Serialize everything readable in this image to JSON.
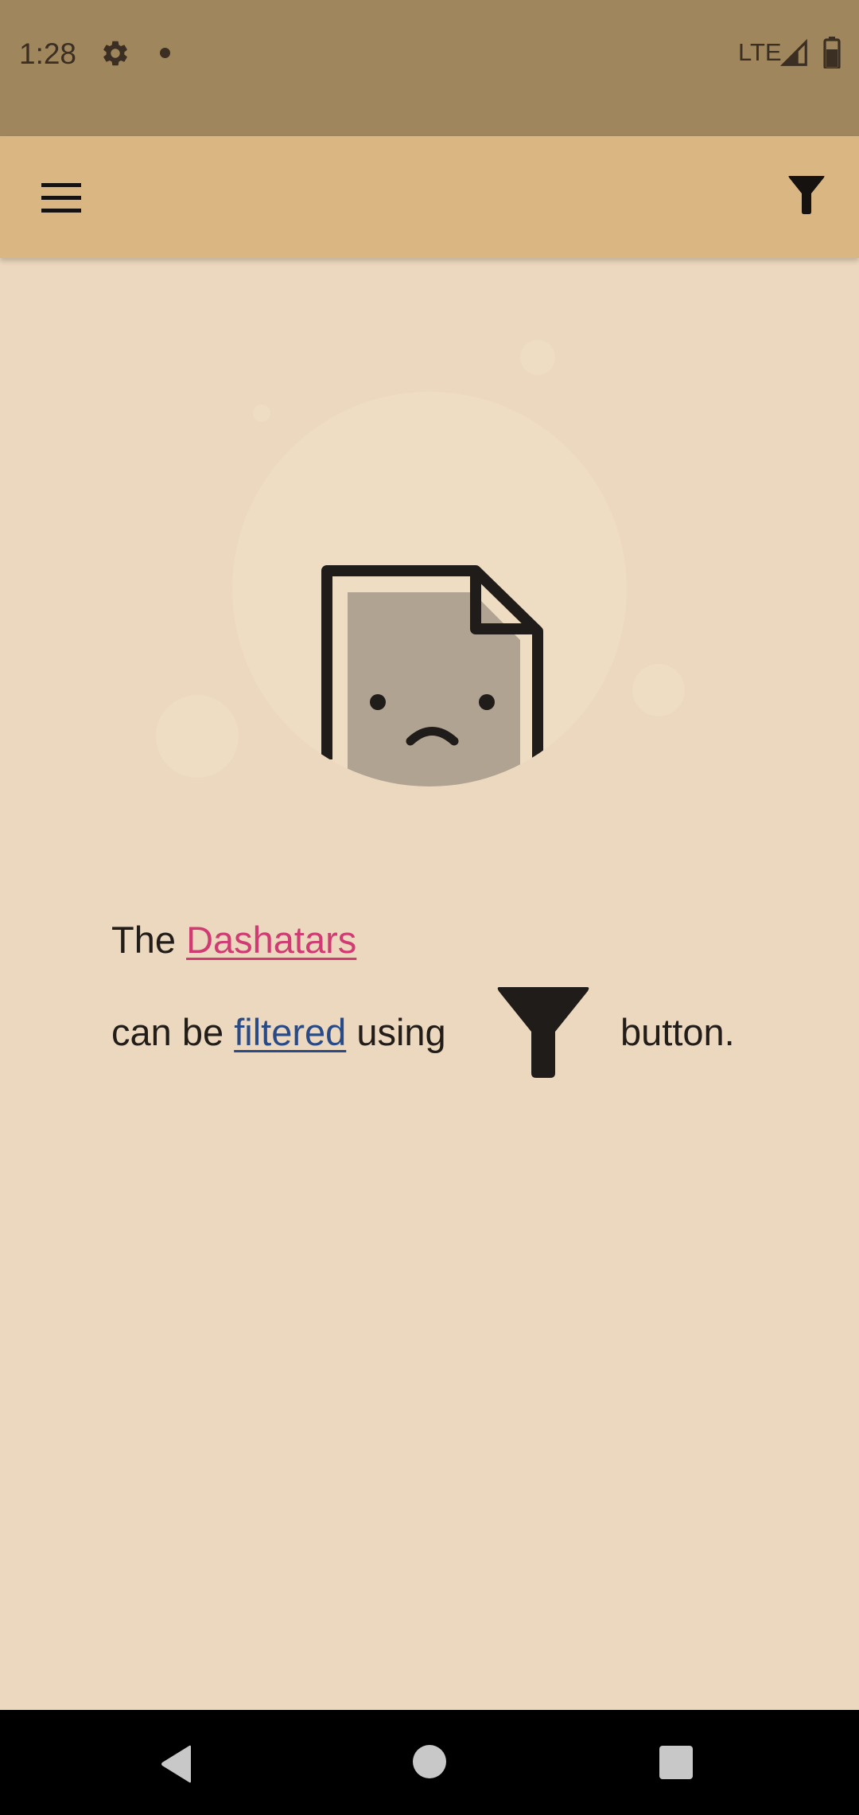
{
  "status_bar": {
    "time": "1:28",
    "network": "LTE",
    "icons": [
      "gear-icon",
      "notification-dot-icon",
      "signal-icon",
      "battery-icon"
    ]
  },
  "app_bar": {
    "menu_icon": "hamburger-menu-icon",
    "filter_icon": "filter-funnel-icon"
  },
  "empty_state": {
    "illustration": "sad-document-icon",
    "line1_prefix": "The",
    "line1_link": "Dashatars",
    "line2_prefix": "can be",
    "line2_link": "filtered",
    "line2_mid": "using",
    "line2_suffix": "button."
  },
  "nav_bar": {
    "icons": [
      "back-icon",
      "home-icon",
      "recents-icon"
    ]
  },
  "colors": {
    "status_bar": "#a0865d",
    "app_bar": "#d9b682",
    "background": "#ecd8be",
    "link_pink": "#cf3b72",
    "link_blue": "#284a86",
    "text": "#221d18",
    "nav_bar": "#000000"
  }
}
